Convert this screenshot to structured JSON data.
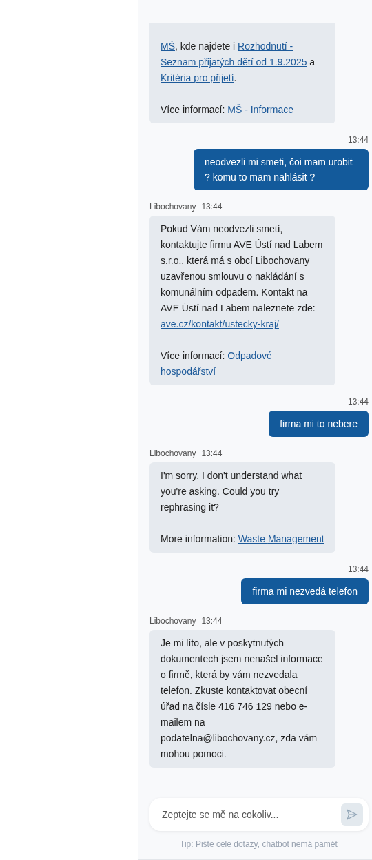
{
  "messages": [
    {
      "kind": "bot",
      "paragraphs": [
        [
          {
            "kind": "link",
            "text": "MŠ"
          },
          {
            "kind": "text",
            "text": ", kde najdete i "
          },
          {
            "kind": "link",
            "text": "Rozhodnutí - "
          },
          {
            "kind": "link",
            "text": "Seznam přijatých dětí od 1.9.2025"
          },
          {
            "kind": "text",
            "text": " a "
          },
          {
            "kind": "link",
            "text": "Kritéria pro přijetí"
          },
          {
            "kind": "text",
            "text": "."
          }
        ],
        [
          {
            "kind": "text",
            "text": "Více informací: "
          },
          {
            "kind": "link",
            "text": "MŠ - Informace"
          }
        ]
      ]
    },
    {
      "kind": "user",
      "time": "13:44",
      "text": "neodvezli mi smeti, čoi mam urobit ? komu to mam nahlásit ?"
    },
    {
      "kind": "bot",
      "sender": "Libochovany",
      "time": "13:44",
      "paragraphs": [
        [
          {
            "kind": "text",
            "text": "Pokud Vám neodvezli smetí, kontaktujte firmu AVE Ústí nad Labem s.r.o., která má s obcí Libochovany uzavřenou smlouvu o nakládání s komunálním odpadem. Kontakt na AVE Ústí nad Labem naleznete zde: "
          },
          {
            "kind": "link",
            "text": "ave.cz/kontakt/ustecky-kraj/"
          }
        ],
        [
          {
            "kind": "text",
            "text": "Více informací: "
          },
          {
            "kind": "link",
            "text": "Odpadové "
          },
          {
            "kind": "link",
            "text": "hospodářství"
          }
        ]
      ]
    },
    {
      "kind": "user",
      "time": "13:44",
      "text": "firma mi to nebere"
    },
    {
      "kind": "bot",
      "sender": "Libochovany",
      "time": "13:44",
      "paragraphs": [
        [
          {
            "kind": "text",
            "text": "I'm sorry, I don't understand what you're asking. Could you try rephrasing it?"
          }
        ],
        [
          {
            "kind": "text",
            "text": "More information: "
          },
          {
            "kind": "link",
            "text": "Waste "
          },
          {
            "kind": "link",
            "text": "Management"
          }
        ]
      ]
    },
    {
      "kind": "user",
      "time": "13:44",
      "text": "firma mi nezvedá telefon"
    },
    {
      "kind": "bot",
      "sender": "Libochovany",
      "time": "13:44",
      "paragraphs": [
        [
          {
            "kind": "text",
            "text": "Je mi líto, ale v poskytnutých dokumentech jsem nenašel informace o firmě, která by vám nezvedala telefon. Zkuste kontaktovat obecní úřad na čísle 416 746 129 nebo e-mailem na podatelna@libochovany.cz, zda vám mohou pomoci."
          }
        ]
      ]
    }
  ],
  "composer": {
    "placeholder": "Zeptejte se mě na cokoliv..."
  },
  "tip": "Tip: Pište celé dotazy, chatbot nemá paměť"
}
